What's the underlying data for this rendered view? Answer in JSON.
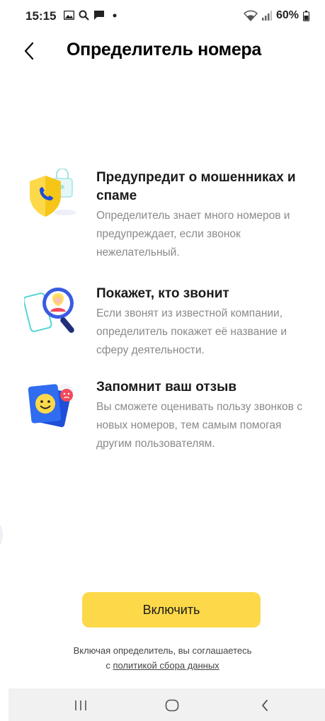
{
  "status_bar": {
    "time": "15:15",
    "battery": "60%",
    "icons_left": [
      "image-icon",
      "search-icon",
      "message-icon",
      "dot-icon"
    ],
    "icons_right": [
      "wifi-icon",
      "signal-icon",
      "battery-icon"
    ]
  },
  "header": {
    "back_icon": "chevron-left-icon",
    "title": "Определитель номера"
  },
  "features": [
    {
      "icon": "shield-phone-lock-icon",
      "title": "Предупредит о мошенниках и спаме",
      "description": "Определитель знает много номеров и предупреждает, если звонок нежелательный."
    },
    {
      "icon": "magnifier-person-icon",
      "title": "Покажет, кто звонит",
      "description": "Если звонят из известной компании, определитель покажет её название и сферу деятельности."
    },
    {
      "icon": "smiley-rating-icon",
      "title": "Запомнит ваш отзыв",
      "description": "Вы сможете оценивать пользу звонков с новых номеров, тем самым помогая другим пользователям."
    }
  ],
  "enable_button": {
    "label": "Включить",
    "color": "#fdd94a"
  },
  "consent": {
    "text_line1": "Включая определитель, вы соглашаетесь",
    "text_prefix": "с",
    "link": "политикой сбора данных"
  },
  "nav_bar": {
    "buttons": [
      "recents-icon",
      "home-icon",
      "back-icon"
    ]
  }
}
